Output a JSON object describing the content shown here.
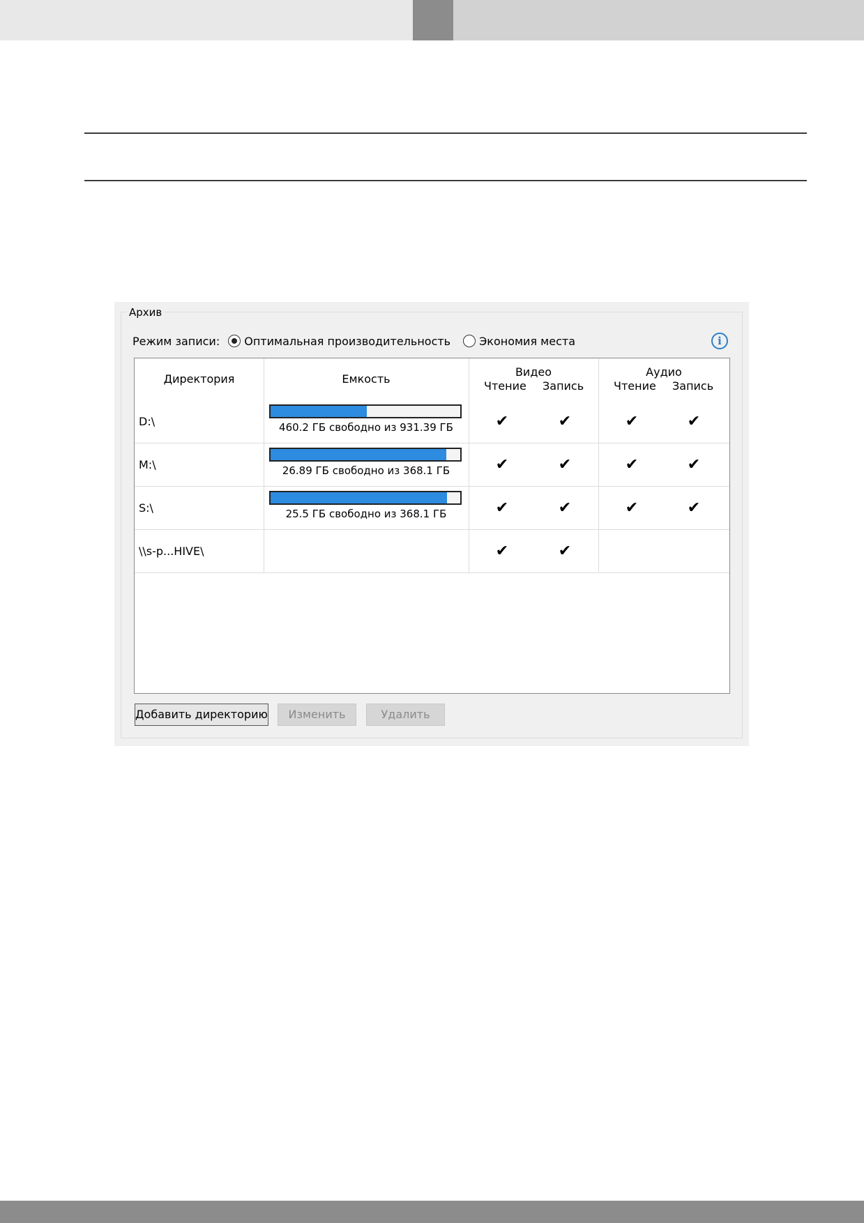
{
  "archive": {
    "group_title": "Архив",
    "mode_label": "Режим записи:",
    "mode_options": [
      {
        "label": "Оптимальная производительность",
        "selected": true
      },
      {
        "label": "Экономия места",
        "selected": false
      }
    ],
    "info_icon": "info-icon",
    "info_glyph": "i",
    "table": {
      "headers": {
        "directory": "Директория",
        "capacity": "Емкость",
        "video": "Видео",
        "audio": "Аудио",
        "read": "Чтение",
        "write": "Запись"
      },
      "check_glyph": "✔",
      "rows": [
        {
          "directory": "D:\\",
          "capacity_text": "460.2 ГБ свободно из 931.39 ГБ",
          "used_fraction": 0.506,
          "video_read": true,
          "video_write": true,
          "audio_read": true,
          "audio_write": true
        },
        {
          "directory": "M:\\",
          "capacity_text": "26.89 ГБ свободно из 368.1 ГБ",
          "used_fraction": 0.927,
          "video_read": true,
          "video_write": true,
          "audio_read": true,
          "audio_write": true
        },
        {
          "directory": "S:\\",
          "capacity_text": "25.5 ГБ свободно из 368.1 ГБ",
          "used_fraction": 0.931,
          "video_read": true,
          "video_write": true,
          "audio_read": true,
          "audio_write": true
        },
        {
          "directory": "\\\\s-p...HIVE\\",
          "capacity_text": "",
          "used_fraction": null,
          "video_read": true,
          "video_write": true,
          "audio_read": false,
          "audio_write": false
        }
      ]
    },
    "buttons": {
      "add": "Добавить директорию",
      "edit": "Изменить",
      "delete": "Удалить"
    },
    "colors": {
      "progress_fill": "#2d8be0",
      "info_accent": "#2b7fc9"
    }
  }
}
